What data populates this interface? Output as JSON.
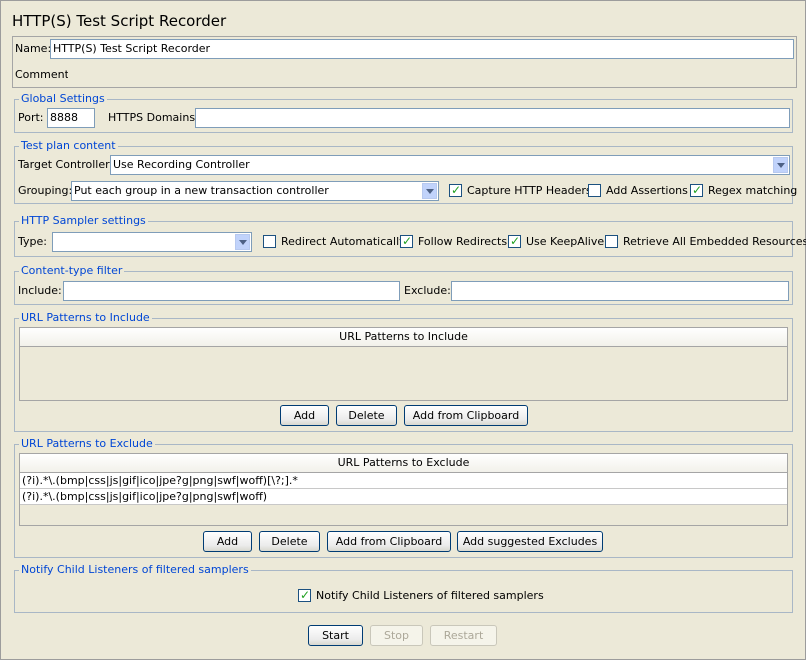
{
  "title": "HTTP(S) Test Script Recorder",
  "name": {
    "label": "Name:",
    "value": "HTTP(S) Test Script Recorder"
  },
  "comments": {
    "label": "Comments:",
    "value": ""
  },
  "global_settings": {
    "legend": "Global Settings",
    "port_label": "Port:",
    "port_value": "8888",
    "https_label": "HTTPS Domains :",
    "https_value": ""
  },
  "test_plan": {
    "legend": "Test plan content",
    "target_label": "Target Controller:",
    "target_value": "Use Recording Controller",
    "grouping_label": "Grouping:",
    "grouping_value": "Put each group in a new transaction controller",
    "capture_headers": "Capture HTTP Headers",
    "add_assertions": "Add Assertions",
    "regex_matching": "Regex matching"
  },
  "sampler": {
    "legend": "HTTP Sampler settings",
    "type_label": "Type:",
    "type_value": "",
    "redirect_auto": "Redirect Automatically",
    "follow_redirects": "Follow Redirects",
    "keepalive": "Use KeepAlive",
    "retrieve_embedded": "Retrieve All Embedded Resources"
  },
  "content_filter": {
    "legend": "Content-type filter",
    "include_label": "Include:",
    "include_value": "",
    "exclude_label": "Exclude:",
    "exclude_value": ""
  },
  "include_patterns": {
    "legend": "URL Patterns to Include",
    "header": "URL Patterns to Include",
    "add": "Add",
    "delete": "Delete",
    "clipboard": "Add from Clipboard"
  },
  "exclude_patterns": {
    "legend": "URL Patterns to Exclude",
    "header": "URL Patterns to Exclude",
    "rows": [
      "(?i).*\\.(bmp|css|js|gif|ico|jpe?g|png|swf|woff)[\\?;].*",
      "(?i).*\\.(bmp|css|js|gif|ico|jpe?g|png|swf|woff)"
    ],
    "add": "Add",
    "delete": "Delete",
    "clipboard": "Add from Clipboard",
    "suggested": "Add suggested Excludes"
  },
  "notify": {
    "legend": "Notify Child Listeners of filtered samplers",
    "checkbox": "Notify Child Listeners of filtered samplers"
  },
  "controls": {
    "start": "Start",
    "stop": "Stop",
    "restart": "Restart"
  },
  "colors": {
    "legend": "#0046d5",
    "background": "#ece9d8"
  }
}
